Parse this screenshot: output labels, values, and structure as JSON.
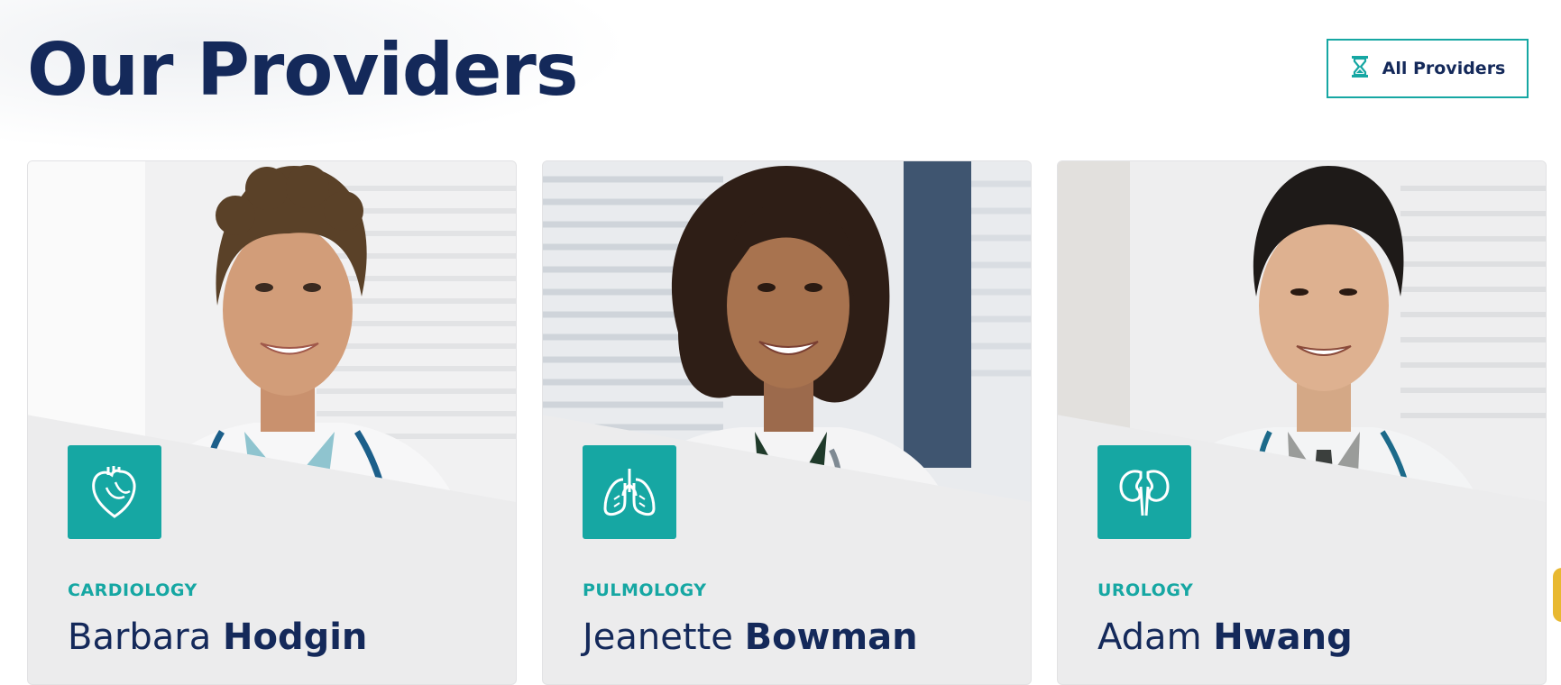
{
  "header": {
    "title": "Our Providers",
    "all_providers_label": "All Providers",
    "all_providers_icon": "hourglass-icon"
  },
  "colors": {
    "navy": "#14295a",
    "teal": "#16a7a3",
    "card_bg": "#ececed"
  },
  "providers": [
    {
      "specialty": "CARDIOLOGY",
      "first_name": "Barbara",
      "last_name": "Hodgin",
      "icon": "heart-icon"
    },
    {
      "specialty": "PULMOLOGY",
      "first_name": "Jeanette",
      "last_name": "Bowman",
      "icon": "lungs-icon"
    },
    {
      "specialty": "UROLOGY",
      "first_name": "Adam",
      "last_name": "Hwang",
      "icon": "kidneys-icon"
    }
  ]
}
